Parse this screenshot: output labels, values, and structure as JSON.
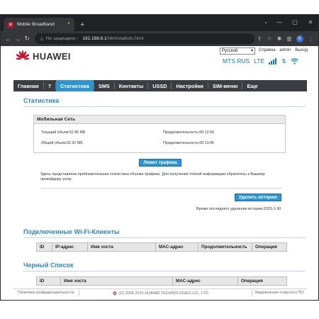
{
  "browser": {
    "tab_title": "Mobile Broadband",
    "tab_close": "×",
    "new_tab": "+",
    "not_secure": "Не защищено",
    "url_host": "192.168.8.1",
    "url_path": "/html/statistic.html",
    "profile_initial": "K"
  },
  "header": {
    "brand": "HUAWEI",
    "language": "Русский",
    "help": "Справка",
    "user": "admin",
    "logout": "Выход",
    "operator": "MTS RUS",
    "network": "LTE",
    "colors": {
      "accent": "#2d95d0",
      "brand_red": "#c8102e"
    }
  },
  "nav": {
    "items": [
      "Главная",
      "?",
      "Статистика",
      "SMS",
      "Контакты",
      "USSD",
      "Настройки",
      "SIM-меню",
      "Еще"
    ],
    "active_index": 2
  },
  "stats": {
    "title": "Статистика",
    "box_title": "Мобильная Сеть",
    "current_volume": "Текущий объем:52.86 МБ",
    "current_duration": "Продолжительность:00:12:56",
    "total_volume": "Общий объем:52.91 МБ",
    "total_duration": "Продолжительность:00:13:06",
    "traffic_limit_button": "Лимит трафика",
    "note": "Здесь представлена приблизительная статистика объема трафика. Для получения точной информации обратитесь к Вашему провайдеру услуг.",
    "delete_history_button": "Удалить историю",
    "last_delete": "Время последнего удаления истории:2023-1-30"
  },
  "wifi_clients": {
    "title": "Подключенные Wi-Fi-Клиенты",
    "columns": [
      "ID",
      "IP-адрес",
      "Имя хоста",
      "MAC-адрес",
      "Продолжительность",
      "Операция"
    ]
  },
  "blacklist": {
    "title": "Черный Список",
    "columns": [
      "ID",
      "Имя хоста",
      "MAC-адрес",
      "Операция"
    ]
  },
  "footer": {
    "privacy": "Политика конфиденциальности",
    "copyright": "(C) 2006-2015 HUAWEI TECHNOLOGIES CO., LTD.",
    "open_source": "Уведомление открытого ПО"
  }
}
